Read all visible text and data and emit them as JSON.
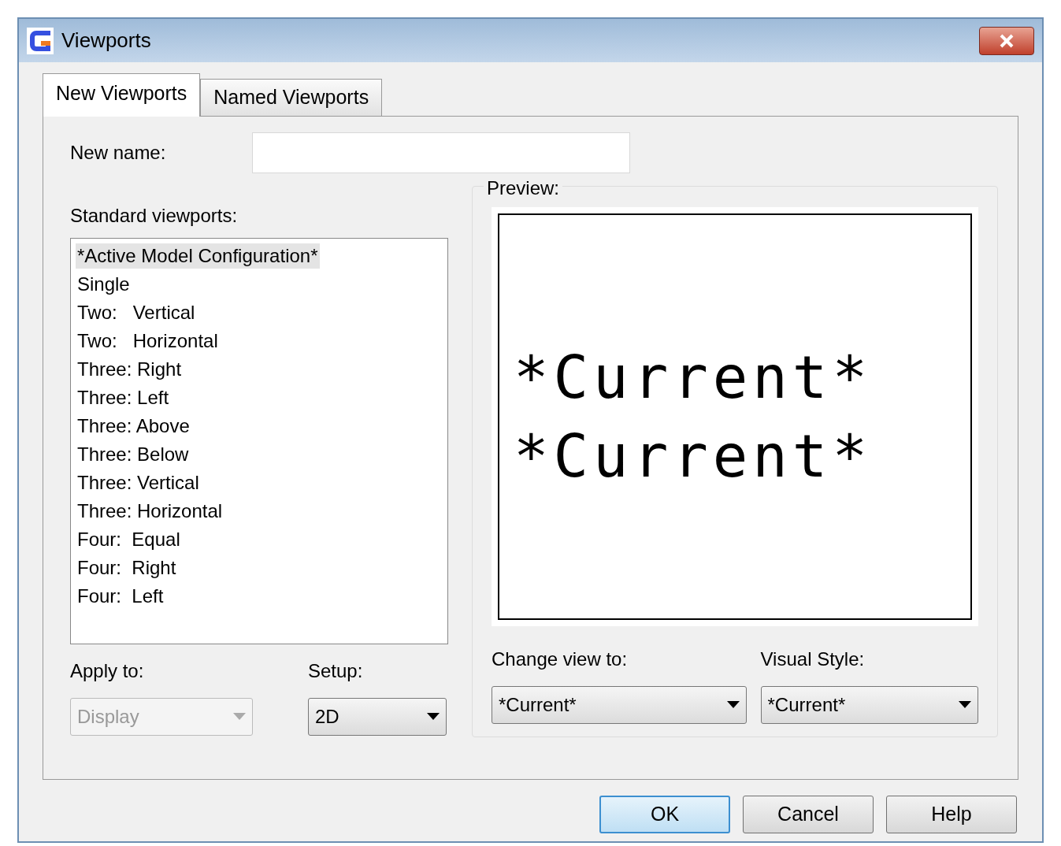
{
  "window": {
    "title": "Viewports"
  },
  "tabs": [
    {
      "label": "New Viewports",
      "selected": true
    },
    {
      "label": "Named Viewports",
      "selected": false
    }
  ],
  "new_name": {
    "label": "New name:"
  },
  "standard_viewports": {
    "label": "Standard viewports:",
    "items": [
      {
        "label": "*Active Model Configuration*",
        "selected": true
      },
      {
        "label": "Single",
        "selected": false
      },
      {
        "label": "Two:   Vertical",
        "selected": false
      },
      {
        "label": "Two:   Horizontal",
        "selected": false
      },
      {
        "label": "Three: Right",
        "selected": false
      },
      {
        "label": "Three: Left",
        "selected": false
      },
      {
        "label": "Three: Above",
        "selected": false
      },
      {
        "label": "Three: Below",
        "selected": false
      },
      {
        "label": "Three: Vertical",
        "selected": false
      },
      {
        "label": "Three: Horizontal",
        "selected": false
      },
      {
        "label": "Four:  Equal",
        "selected": false
      },
      {
        "label": "Four:  Right",
        "selected": false
      },
      {
        "label": "Four:  Left",
        "selected": false
      }
    ]
  },
  "preview": {
    "label": "Preview:",
    "lines": [
      "*Current*",
      "*Current*"
    ]
  },
  "dropdowns": [
    {
      "label": "Apply to:",
      "value": "Display",
      "disabled": true
    },
    {
      "label": "Setup:",
      "value": "2D",
      "disabled": false
    },
    {
      "label": "Change view to:",
      "value": "*Current*",
      "disabled": false
    },
    {
      "label": "Visual Style:",
      "value": "*Current*",
      "disabled": false
    }
  ],
  "buttons": [
    {
      "label": "OK",
      "default": true
    },
    {
      "label": "Cancel",
      "default": false
    },
    {
      "label": "Help",
      "default": false
    }
  ]
}
